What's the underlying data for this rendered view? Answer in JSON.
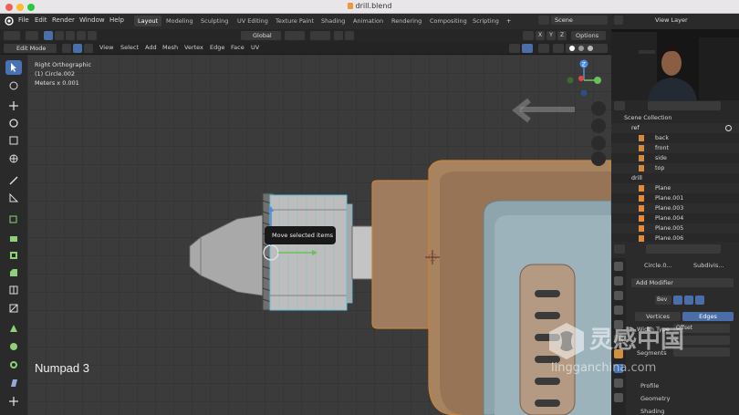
{
  "window": {
    "title": "drill.blend"
  },
  "menubar": {
    "items": [
      "File",
      "Edit",
      "Render",
      "Window",
      "Help"
    ],
    "workspaces": [
      "Layout",
      "Modeling",
      "Sculpting",
      "UV Editing",
      "Texture Paint",
      "Shading",
      "Animation",
      "Rendering",
      "Compositing",
      "Scripting"
    ],
    "active_workspace": "Layout",
    "scene_label": "Scene",
    "view_layer_label": "View Layer"
  },
  "header": {
    "orientation": "Global",
    "options_label": "Options",
    "axis_x": "X",
    "axis_y": "Y",
    "axis_z": "Z",
    "mode": "Edit Mode",
    "menu": [
      "View",
      "Select",
      "Add",
      "Mesh",
      "Vertex",
      "Edge",
      "Face",
      "UV"
    ]
  },
  "viewport": {
    "view_name": "Right Orthographic",
    "object_name": "(1) Circle.002",
    "units": "Meters x 0.001",
    "tooltip": "Move selected items",
    "key_overlay": "Numpad 3",
    "gizmo_z": "Z"
  },
  "outliner": {
    "root": "Scene Collection",
    "collections": [
      {
        "name": "ref",
        "children": [
          "back",
          "front",
          "side",
          "top"
        ]
      },
      {
        "name": "drill",
        "children": [
          "Plane",
          "Plane.001",
          "Plane.003",
          "Plane.004",
          "Plane.005",
          "Plane.006"
        ]
      }
    ]
  },
  "properties": {
    "object_name": "Circle.0...",
    "modifier_name": "Subdivis...",
    "add_modifier": "Add Modifier",
    "bevel_label": "Bev",
    "affect_options": [
      "Vertices",
      "Edges"
    ],
    "affect_selected": "Edges",
    "width_type_label": "Width Type",
    "width_type_value": "Offset",
    "segments_label": "Segments",
    "sections": [
      "Profile",
      "Geometry",
      "Shading"
    ]
  },
  "watermark": {
    "brand_cn": "灵感中国",
    "url": "lingganchina.com"
  },
  "colors": {
    "accent_blue": "#4772b3",
    "selection_cyan": "#5ec3e0",
    "drill_body": "#a07c5e",
    "drill_orange_edge": "#c8823c"
  }
}
